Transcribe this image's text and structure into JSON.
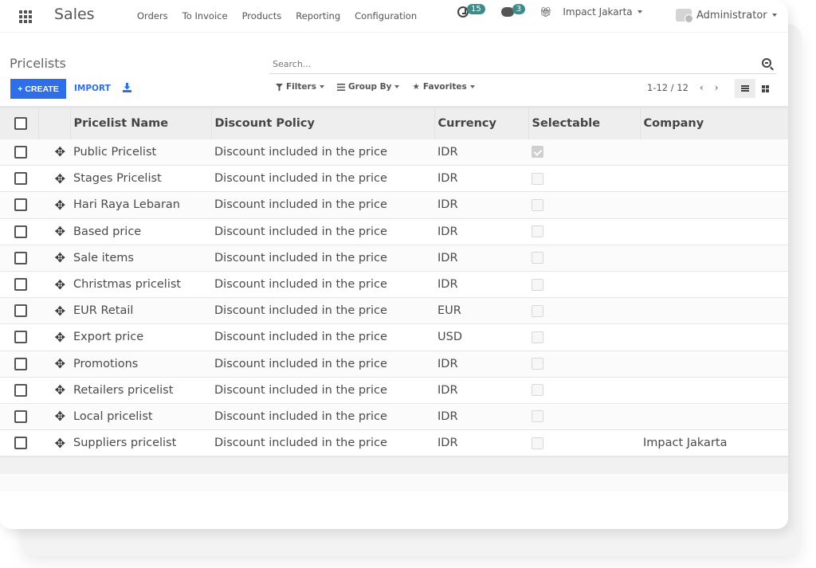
{
  "navbar": {
    "app_title": "Sales",
    "menu": [
      "Orders",
      "To Invoice",
      "Products",
      "Reporting",
      "Configuration"
    ],
    "activity_count": "15",
    "messages_count": "3",
    "company": "Impact Jakarta",
    "user": "Administrator",
    "colors": {
      "badge": "#3d8c8c"
    }
  },
  "control_panel": {
    "breadcrumb": "Pricelists",
    "create_label": "+ CREATE",
    "import_label": "IMPORT",
    "search_placeholder": "Search...",
    "filters_label": "Filters",
    "group_by_label": "Group By",
    "favorites_label": "Favorites",
    "pager": "1-12 / 12",
    "colors": {
      "primary": "#2f6ee9"
    }
  },
  "table": {
    "columns": [
      "Pricelist Name",
      "Discount Policy",
      "Currency",
      "Selectable",
      "Company"
    ],
    "rows": [
      {
        "name": "Public Pricelist",
        "policy": "Discount included in the price",
        "currency": "IDR",
        "selectable": true,
        "company": ""
      },
      {
        "name": "Stages Pricelist",
        "policy": "Discount included in the price",
        "currency": "IDR",
        "selectable": false,
        "company": ""
      },
      {
        "name": "Hari Raya Lebaran",
        "policy": "Discount included in the price",
        "currency": "IDR",
        "selectable": false,
        "company": ""
      },
      {
        "name": "Based price",
        "policy": "Discount included in the price",
        "currency": "IDR",
        "selectable": false,
        "company": ""
      },
      {
        "name": "Sale items",
        "policy": "Discount included in the price",
        "currency": "IDR",
        "selectable": false,
        "company": ""
      },
      {
        "name": "Christmas pricelist",
        "policy": "Discount included in the price",
        "currency": "IDR",
        "selectable": false,
        "company": ""
      },
      {
        "name": "EUR Retail",
        "policy": "Discount included in the price",
        "currency": "EUR",
        "selectable": false,
        "company": ""
      },
      {
        "name": "Export price",
        "policy": "Discount included in the price",
        "currency": "USD",
        "selectable": false,
        "company": ""
      },
      {
        "name": "Promotions",
        "policy": "Discount included in the price",
        "currency": "IDR",
        "selectable": false,
        "company": ""
      },
      {
        "name": "Retailers pricelist",
        "policy": "Discount included in the price",
        "currency": "IDR",
        "selectable": false,
        "company": ""
      },
      {
        "name": "Local pricelist",
        "policy": "Discount included in the price",
        "currency": "IDR",
        "selectable": false,
        "company": ""
      },
      {
        "name": "Suppliers pricelist",
        "policy": "Discount included in the price",
        "currency": "IDR",
        "selectable": false,
        "company": "Impact Jakarta"
      }
    ]
  }
}
